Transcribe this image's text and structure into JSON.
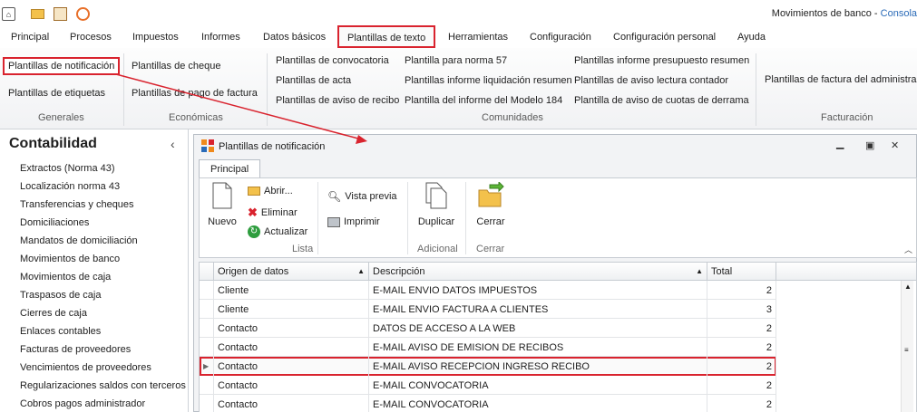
{
  "window": {
    "title": "Movimientos de banco",
    "separator": "-",
    "app": "Consola"
  },
  "menu": [
    "Principal",
    "Procesos",
    "Impuestos",
    "Informes",
    "Datos básicos",
    "Plantillas de texto",
    "Herramientas",
    "Configuración",
    "Configuración personal",
    "Ayuda"
  ],
  "menu_active": "Plantillas de texto",
  "ribbon": {
    "generales": {
      "items": [
        "Plantillas de notificación",
        "Plantillas de etiquetas"
      ],
      "label": "Generales"
    },
    "economicas": {
      "items": [
        "Plantillas de cheque",
        "Plantillas de pago de factura"
      ],
      "label": "Económicas"
    },
    "comunidades": {
      "items": [
        "Plantillas de convocatoria",
        "Plantillas de acta",
        "Plantillas de aviso de recibo",
        "Plantilla para norma 57",
        "Plantillas informe liquidación resumen",
        "Plantilla del informe del Modelo 184",
        "Plantillas informe presupuesto resumen",
        "Plantillas de aviso lectura contador",
        "Plantilla de aviso de cuotas de derrama"
      ],
      "label": "Comunidades"
    },
    "facturacion": {
      "items": [
        "Plantillas de factura del administrador"
      ],
      "label": "Facturación"
    }
  },
  "sidebar": {
    "title": "Contabilidad",
    "collapse": "‹",
    "items": [
      "Extractos (Norma 43)",
      "Localización norma 43",
      "Transferencias y cheques",
      "Domiciliaciones",
      "Mandatos de domiciliación",
      "Movimientos de banco",
      "Movimientos de caja",
      "Traspasos de caja",
      "Cierres de caja",
      "Enlaces contables",
      "Facturas de proveedores",
      "Vencimientos de proveedores",
      "Regularizaciones saldos con terceros",
      "Cobros pagos administrador"
    ]
  },
  "panel": {
    "title": "Plantillas de notificación",
    "tab": "Principal",
    "toolbar": {
      "nuevo": "Nuevo",
      "abrir": "Abrir...",
      "eliminar": "Eliminar",
      "actualizar": "Actualizar",
      "vista_previa": "Vista previa",
      "imprimir": "Imprimir",
      "duplicar": "Duplicar",
      "cerrar": "Cerrar",
      "group_lista": "Lista",
      "group_adicional": "Adicional",
      "group_cerrar": "Cerrar"
    },
    "grid": {
      "columns": [
        "Origen de datos",
        "Descripción",
        "Total"
      ],
      "rows": [
        {
          "origen": "Cliente",
          "desc": "E-MAIL ENVIO DATOS IMPUESTOS",
          "total": "2"
        },
        {
          "origen": "Cliente",
          "desc": "E-MAIL ENVIO FACTURA A CLIENTES",
          "total": "3"
        },
        {
          "origen": "Contacto",
          "desc": "DATOS DE ACCESO A LA WEB",
          "total": "2"
        },
        {
          "origen": "Contacto",
          "desc": "E-MAIL AVISO DE EMISION DE RECIBOS",
          "total": "2"
        },
        {
          "origen": "Contacto",
          "desc": "E-MAIL AVISO RECEPCION INGRESO RECIBO",
          "total": "2"
        },
        {
          "origen": "Contacto",
          "desc": "E-MAIL CONVOCATORIA",
          "total": "2"
        },
        {
          "origen": "Contacto",
          "desc": "E-MAIL CONVOCATORIA",
          "total": "2"
        }
      ],
      "selected_row": 4
    }
  },
  "colors": {
    "highlight": "#d9232e",
    "accent_orange": "#f08a1c"
  }
}
